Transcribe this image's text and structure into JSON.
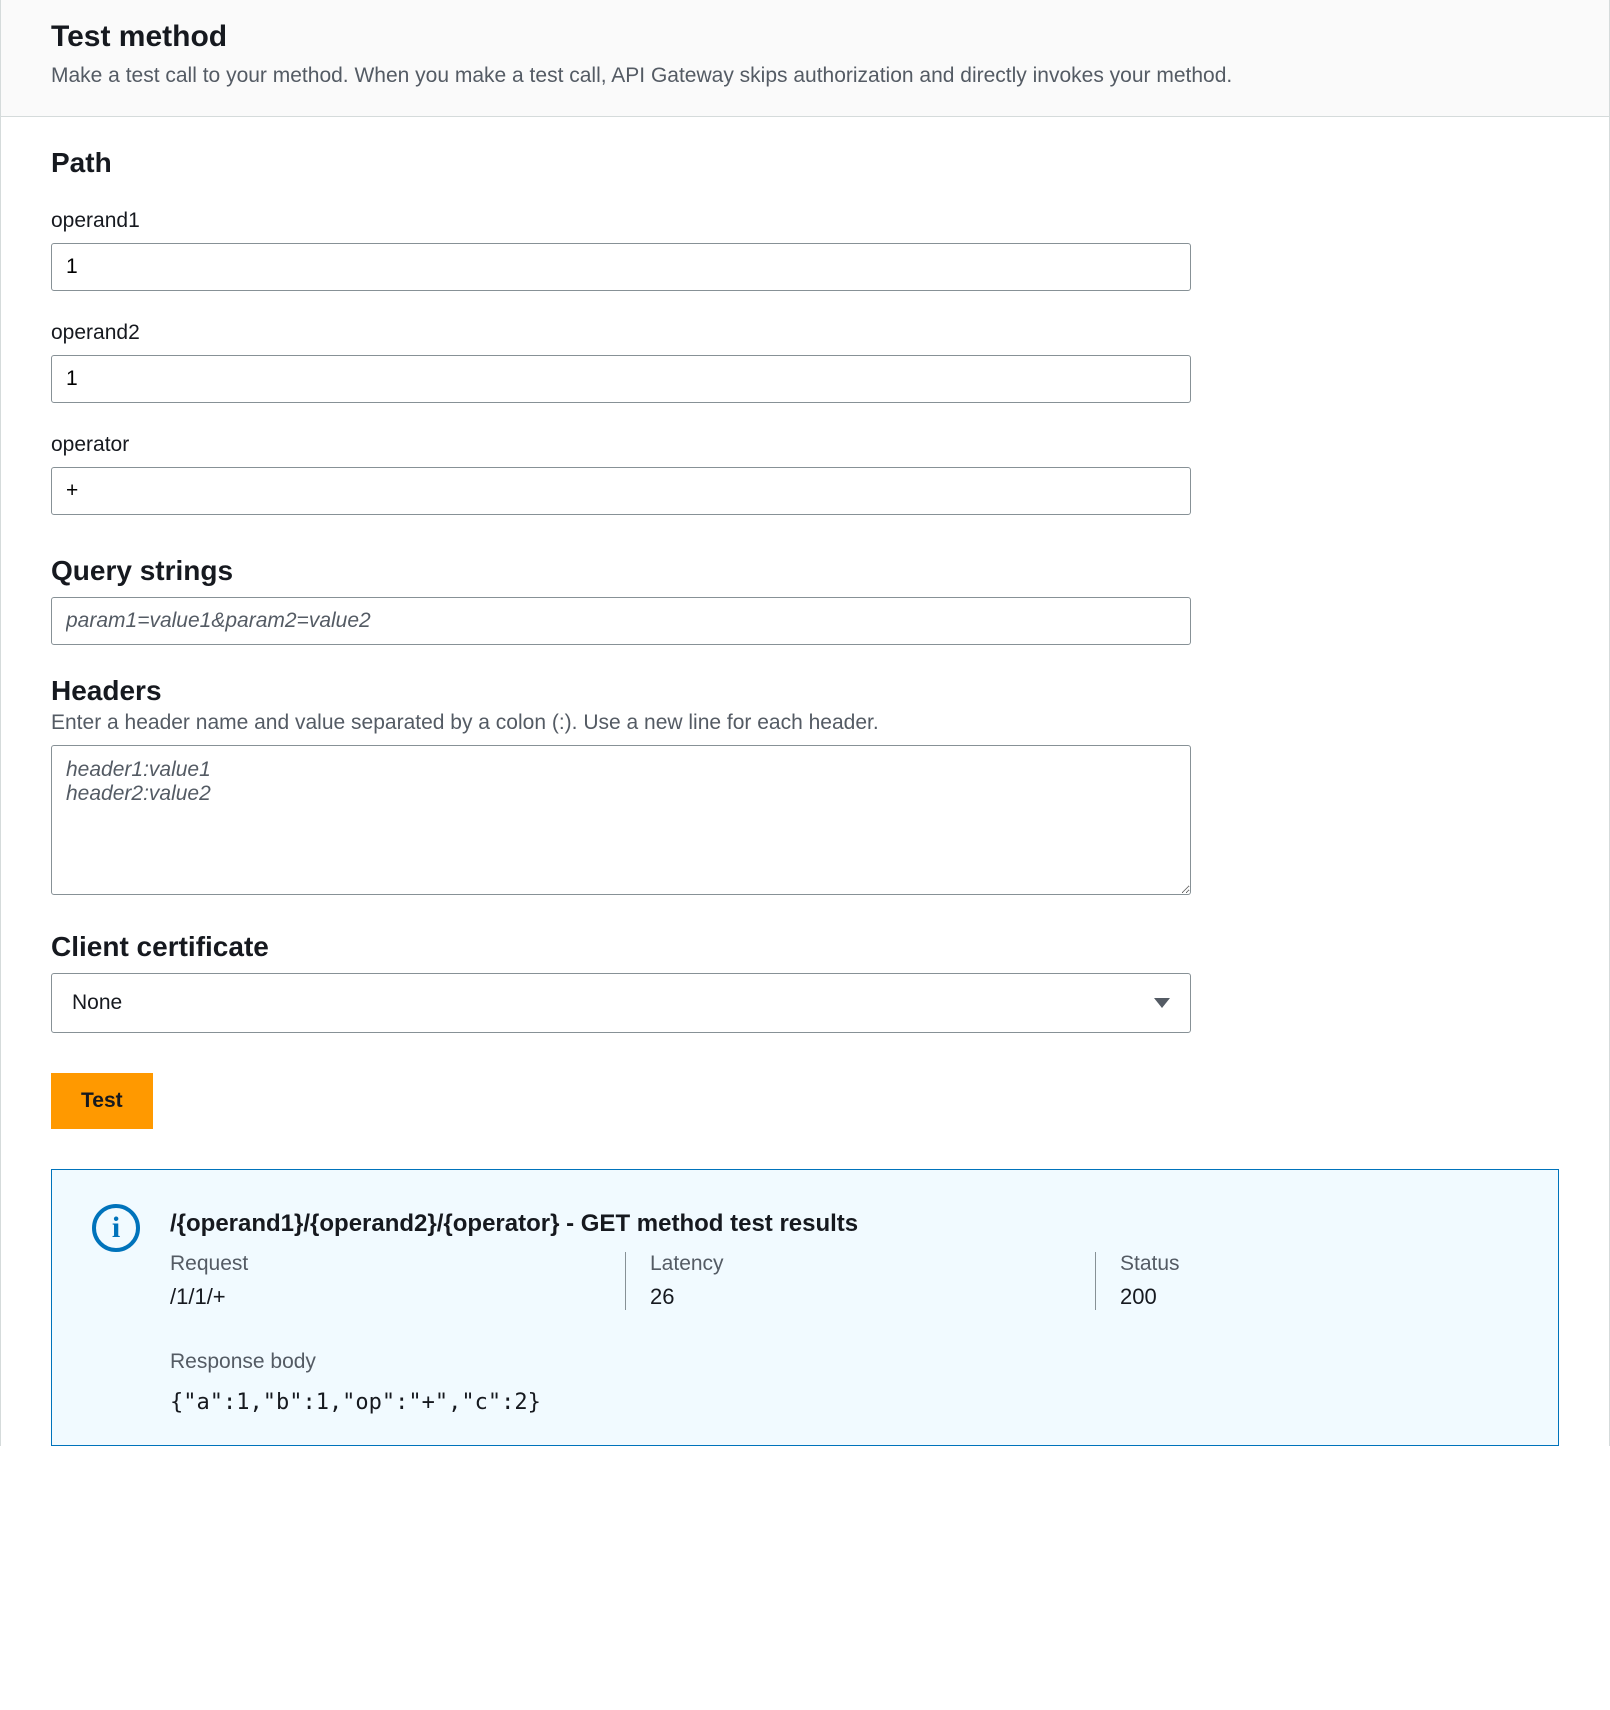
{
  "header": {
    "title": "Test method",
    "subtitle": "Make a test call to your method. When you make a test call, API Gateway skips authorization and directly invokes your method."
  },
  "path": {
    "title": "Path",
    "fields": [
      {
        "label": "operand1",
        "value": "1"
      },
      {
        "label": "operand2",
        "value": "1"
      },
      {
        "label": "operator",
        "value": "+"
      }
    ]
  },
  "query_strings": {
    "title": "Query strings",
    "placeholder": "param1=value1&param2=value2",
    "value": ""
  },
  "headers": {
    "title": "Headers",
    "helper": "Enter a header name and value separated by a colon (:). Use a new line for each header.",
    "placeholder": "header1:value1\nheader2:value2",
    "value": ""
  },
  "client_certificate": {
    "title": "Client certificate",
    "value": "None"
  },
  "buttons": {
    "test_label": "Test"
  },
  "results": {
    "title": "/{operand1}/{operand2}/{operator} - GET method test results",
    "columns": {
      "request_label": "Request",
      "request_value": "/1/1/+",
      "latency_label": "Latency",
      "latency_value": "26",
      "status_label": "Status",
      "status_value": "200"
    },
    "response_body_label": "Response body",
    "response_body": "{\"a\":1,\"b\":1,\"op\":\"+\",\"c\":2}"
  },
  "info_icon_glyph": "i"
}
